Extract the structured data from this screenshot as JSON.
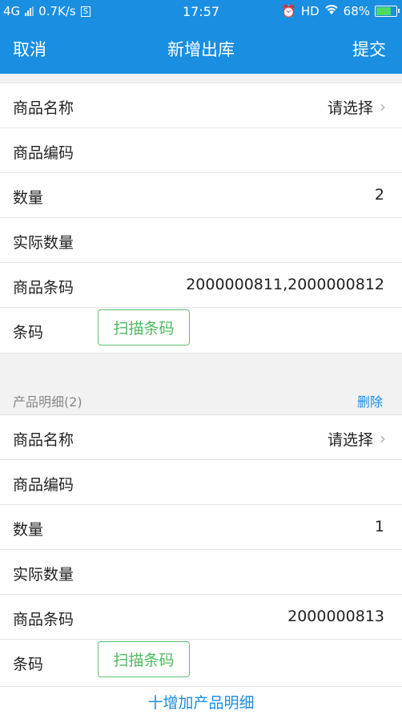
{
  "status_bar": {
    "network": "4G",
    "speed": "0.7K/s",
    "time": "17:57",
    "hd": "HD",
    "battery_percent": "68%"
  },
  "nav": {
    "cancel": "取消",
    "title": "新增出库",
    "submit": "提交"
  },
  "item1": {
    "name_label": "商品名称",
    "name_value": "请选择",
    "code_label": "商品编码",
    "qty_label": "数量",
    "qty_value": "2",
    "actual_qty_label": "实际数量",
    "barcode_label": "商品条码",
    "barcode_value": "2000000811,2000000812",
    "scan_label": "条码",
    "scan_button": "扫描条码"
  },
  "section2": {
    "title": "产品明细(2)",
    "delete": "删除"
  },
  "item2": {
    "name_label": "商品名称",
    "name_value": "请选择",
    "code_label": "商品编码",
    "qty_label": "数量",
    "qty_value": "1",
    "actual_qty_label": "实际数量",
    "barcode_label": "商品条码",
    "barcode_value": "2000000813",
    "scan_label": "条码",
    "scan_button": "扫描条码"
  },
  "add_detail": "十增加产品明细"
}
